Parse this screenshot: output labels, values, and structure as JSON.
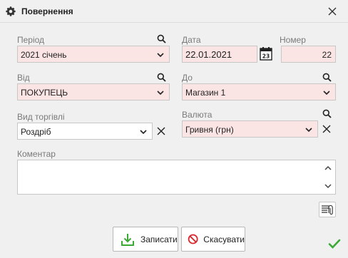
{
  "window": {
    "title": "Повернення"
  },
  "period": {
    "label": "Період",
    "value": "2021 січень"
  },
  "date": {
    "label": "Дата",
    "value": "22.01.2021"
  },
  "number": {
    "label": "Номер",
    "value": "22"
  },
  "from": {
    "label": "Від",
    "value": "ПОКУПЕЦЬ"
  },
  "to": {
    "label": "До",
    "value": "Магазин 1"
  },
  "trade_type": {
    "label": "Вид торгівлі",
    "value": "Роздріб"
  },
  "currency": {
    "label": "Валюта",
    "value": "Гривня (грн)"
  },
  "comment": {
    "label": "Коментар",
    "value": ""
  },
  "buttons": {
    "save": "Записати",
    "cancel": "Скасувати"
  },
  "calendar_day": "23",
  "colors": {
    "required_field": "#fbe4e4",
    "accent_green": "#3aaa35",
    "cancel_red": "#d9262c"
  }
}
